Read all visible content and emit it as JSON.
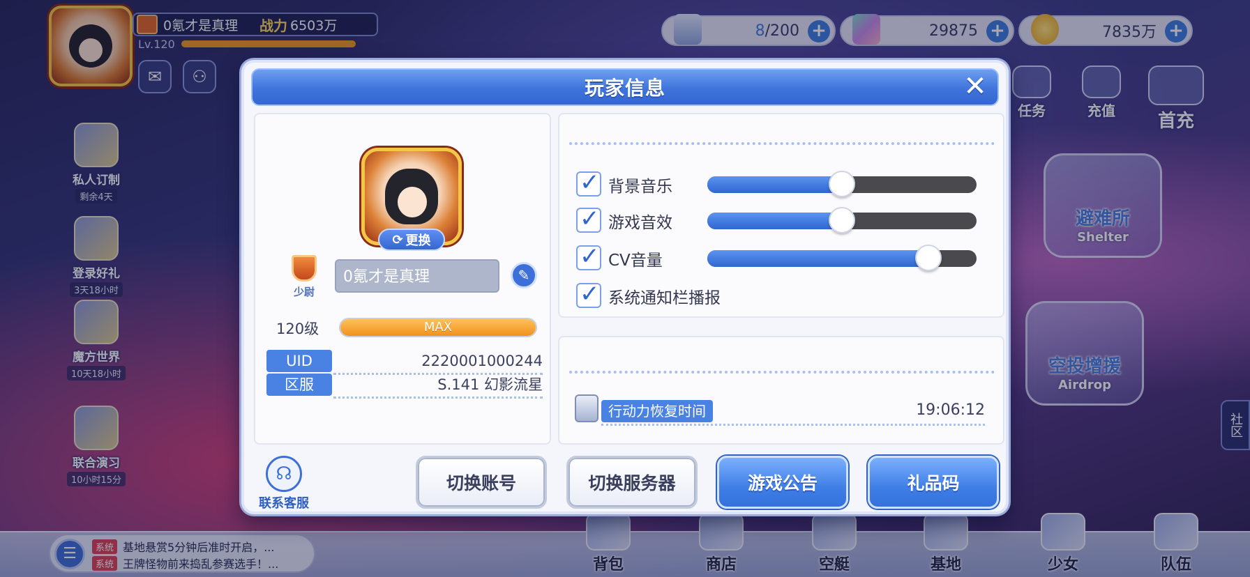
{
  "player": {
    "name": "0氪才是真理",
    "level_short": "Lv.120",
    "power_label": "战力",
    "power_value": "6503万"
  },
  "resources": [
    {
      "icon": "stamina-icon",
      "current": "8",
      "max": "/200"
    },
    {
      "icon": "crystal-icon",
      "value": "29875"
    },
    {
      "icon": "coin-icon",
      "value": "7835万"
    }
  ],
  "top_right_menu": [
    {
      "label": "任务",
      "icon": "task-icon"
    },
    {
      "label": "充值",
      "icon": "recharge-icon"
    },
    {
      "label": "首充",
      "icon": "gift-icon"
    }
  ],
  "left_menu": [
    {
      "label": "私人订制",
      "time": "剩余4天"
    },
    {
      "label": "登录好礼",
      "time": "3天18小时"
    },
    {
      "label": "魔方世界",
      "time": "10天18小时"
    },
    {
      "label": "联合演习",
      "time": "10小时15分"
    }
  ],
  "world_cards": [
    {
      "title": "避难所",
      "subtitle": "Shelter"
    },
    {
      "title": "空投增援",
      "subtitle": "Airdrop"
    }
  ],
  "community_label": "社区",
  "chat": [
    {
      "tag": "系统",
      "text": "基地悬赏5分钟后准时开启，..."
    },
    {
      "tag": "系统",
      "text": "王牌怪物前来捣乱参赛选手！..."
    }
  ],
  "bottom_nav": [
    "背包",
    "商店",
    "空艇",
    "基地",
    "少女",
    "队伍"
  ],
  "modal": {
    "title": "玩家信息",
    "close_symbol": "✕",
    "change_avatar_label": "更换",
    "rank_label": "少尉",
    "name_value": "0氪才是真理",
    "level_text": "120级",
    "level_bar_text": "MAX",
    "level_progress": 1.0,
    "uid_label": "UID",
    "uid_value": "2220001000244",
    "server_label": "区服",
    "server_value": "S.141 幻影流星",
    "settings": [
      {
        "label": "背景音乐",
        "checked": true,
        "volume": 0.5
      },
      {
        "label": "游戏音效",
        "checked": true,
        "volume": 0.5
      },
      {
        "label": "CV音量",
        "checked": true,
        "volume": 0.82
      },
      {
        "label": "系统通知栏播报",
        "checked": true
      }
    ],
    "stamina_label": "行动力恢复时间",
    "stamina_time": "19:06:12",
    "support_label": "联系客服",
    "buttons": [
      "切换账号",
      "切换服务器",
      "游戏公告",
      "礼品码"
    ]
  },
  "colors": {
    "accent": "#3f7fe6",
    "header": "#3e74dc",
    "level_bar": "#f0911d",
    "slider_track": "#4a4a4e"
  }
}
